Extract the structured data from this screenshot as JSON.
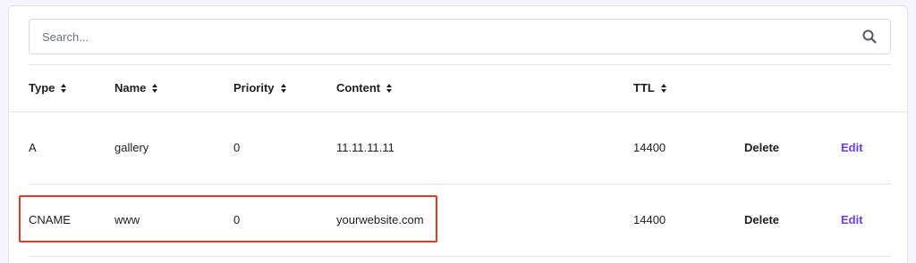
{
  "search": {
    "placeholder": "Search..."
  },
  "columns": [
    {
      "label": "Type"
    },
    {
      "label": "Name"
    },
    {
      "label": "Priority"
    },
    {
      "label": "Content"
    },
    {
      "label": "TTL"
    }
  ],
  "rows": [
    {
      "type": "A",
      "name": "gallery",
      "priority": "0",
      "content": "11.11.11.11",
      "ttl": "14400",
      "delete": "Delete",
      "edit": "Edit"
    },
    {
      "type": "CNAME",
      "name": "www",
      "priority": "0",
      "content": "yourwebsite.com",
      "ttl": "14400",
      "delete": "Delete",
      "edit": "Edit"
    }
  ],
  "colors": {
    "accent": "#673de6",
    "highlight": "#e8371f"
  }
}
